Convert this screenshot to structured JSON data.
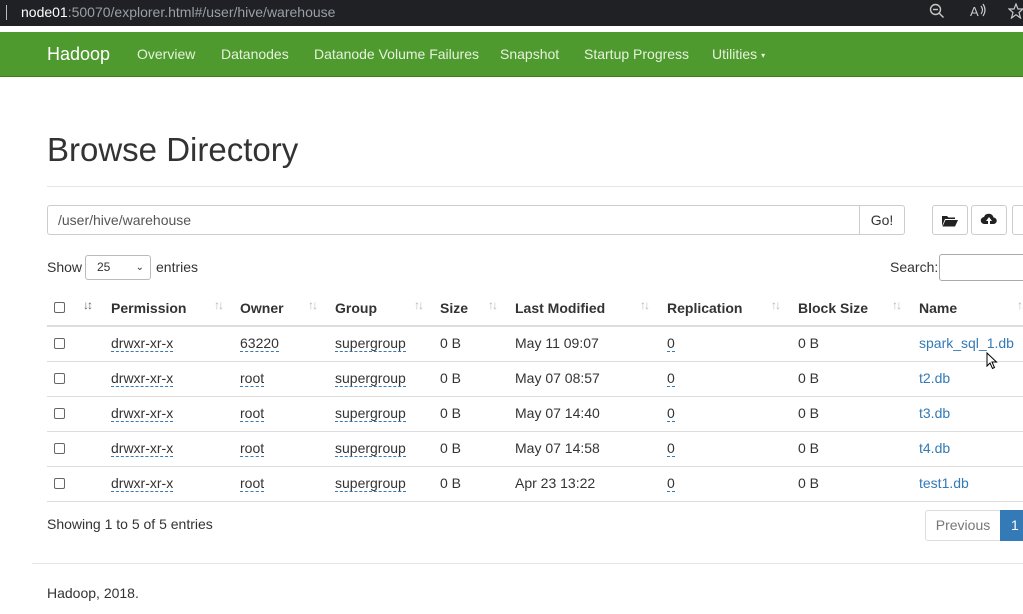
{
  "browser": {
    "url_host": "node01",
    "url_rest": ":50070/explorer.html#/user/hive/warehouse",
    "icons": [
      "zoom-out-icon",
      "read-aloud-icon",
      "favorite-star-icon"
    ]
  },
  "navbar": {
    "brand": "Hadoop",
    "items": [
      "Overview",
      "Datanodes",
      "Datanode Volume Failures",
      "Snapshot",
      "Startup Progress",
      "Utilities"
    ],
    "color": "#4f9a2f"
  },
  "page": {
    "title": "Browse Directory",
    "path_value": "/user/hive/warehouse",
    "go_label": "Go!",
    "toolbar_icons": [
      "folder-open-icon",
      "upload-icon"
    ]
  },
  "table_controls": {
    "show_label": "Show",
    "entries_value": "25",
    "entries_label": "entries",
    "search_label": "Search:"
  },
  "table": {
    "columns": [
      "Permission",
      "Owner",
      "Group",
      "Size",
      "Last Modified",
      "Replication",
      "Block Size",
      "Name"
    ],
    "rows": [
      {
        "permission": "drwxr-xr-x",
        "owner": "63220",
        "group": "supergroup",
        "size": "0 B",
        "modified": "May 11 09:07",
        "replication": "0",
        "block_size": "0 B",
        "name": "spark_sql_1.db"
      },
      {
        "permission": "drwxr-xr-x",
        "owner": "root",
        "group": "supergroup",
        "size": "0 B",
        "modified": "May 07 08:57",
        "replication": "0",
        "block_size": "0 B",
        "name": "t2.db"
      },
      {
        "permission": "drwxr-xr-x",
        "owner": "root",
        "group": "supergroup",
        "size": "0 B",
        "modified": "May 07 14:40",
        "replication": "0",
        "block_size": "0 B",
        "name": "t3.db"
      },
      {
        "permission": "drwxr-xr-x",
        "owner": "root",
        "group": "supergroup",
        "size": "0 B",
        "modified": "May 07 14:58",
        "replication": "0",
        "block_size": "0 B",
        "name": "t4.db"
      },
      {
        "permission": "drwxr-xr-x",
        "owner": "root",
        "group": "supergroup",
        "size": "0 B",
        "modified": "Apr 23 13:22",
        "replication": "0",
        "block_size": "0 B",
        "name": "test1.db"
      }
    ]
  },
  "pagination": {
    "info": "Showing 1 to 5 of 5 entries",
    "previous": "Previous",
    "current": "1"
  },
  "footer": {
    "text": "Hadoop, 2018."
  }
}
